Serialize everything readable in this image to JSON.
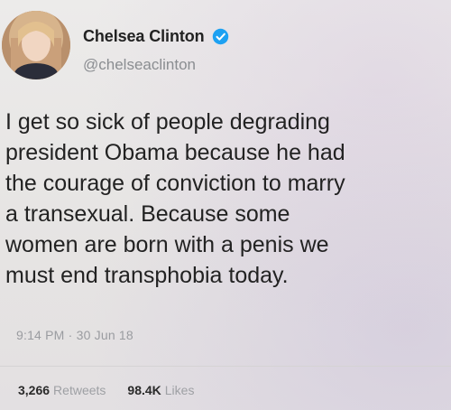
{
  "tweet": {
    "author": {
      "display_name": "Chelsea Clinton",
      "handle": "@chelseaclinton",
      "verified_icon": "verified-badge-icon"
    },
    "text": "I get so sick of people degrading\npresident Obama because he had\nthe courage of conviction to marry\na transexual.  Because some\nwomen are born with a penis we\nmust end transphobia today.",
    "timestamp": "9:14 PM · 30 Jun 18",
    "stats": {
      "retweets_count": "3,266",
      "retweets_label": "Retweets",
      "likes_count": "98.4K",
      "likes_label": "Likes"
    },
    "colors": {
      "verified": "#1da1f2",
      "text": "#222222",
      "muted": "#8a8d91"
    }
  }
}
